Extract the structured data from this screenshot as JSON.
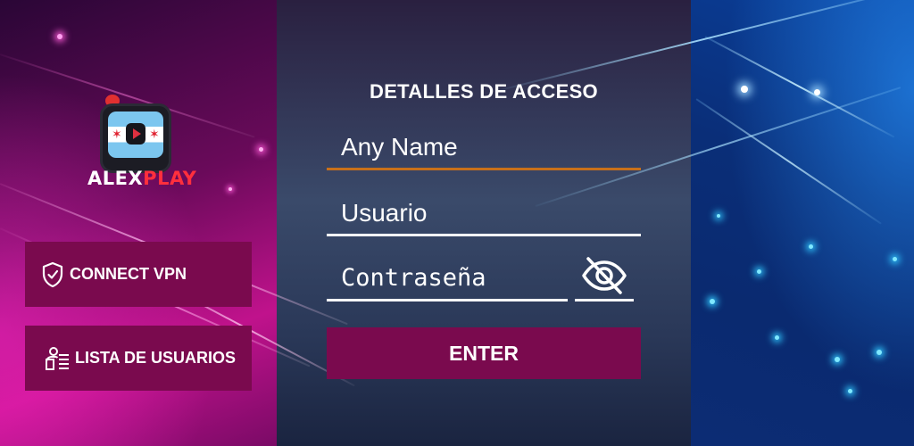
{
  "brand": {
    "name_white": "ALEX",
    "name_red": "PLAY"
  },
  "sidebar": {
    "vpn_label": "CONNECT VPN",
    "users_label": "LISTA DE USUARIOS"
  },
  "login": {
    "title": "DETALLES DE ACCESO",
    "name_placeholder": "Any Name",
    "user_placeholder": "Usuario",
    "password_placeholder": "Contraseña",
    "enter_label": "ENTER"
  },
  "colors": {
    "button_bg": "#7a0a4e",
    "focus_underline": "#c8701a",
    "underline": "#ffffff",
    "brand_red": "#ff2f3d"
  },
  "icons": {
    "vpn": "shield-check-icon",
    "users": "users-list-icon",
    "password_toggle": "eye-off-icon"
  }
}
